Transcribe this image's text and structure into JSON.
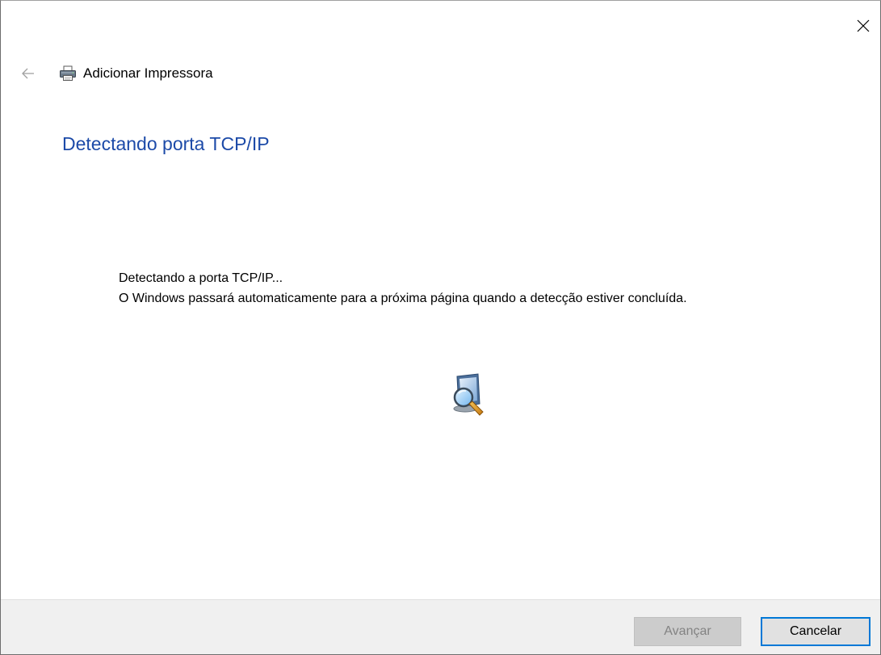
{
  "window": {
    "title": "Adicionar Impressora"
  },
  "page": {
    "heading": "Detectando porta TCP/IP",
    "message_line1": "Detectando a porta TCP/IP...",
    "message_line2": "O Windows passará automaticamente para a próxima página quando a detecção estiver concluída."
  },
  "footer": {
    "next_label": "Avançar",
    "next_enabled": false,
    "cancel_label": "Cancelar"
  },
  "icons": {
    "close": "close-icon",
    "back": "back-arrow-icon",
    "printer": "printer-icon",
    "search": "network-search-icon"
  },
  "colors": {
    "heading": "#1c4aa8",
    "accent_border": "#0078d7",
    "footer_bg": "#f0f0f0"
  }
}
